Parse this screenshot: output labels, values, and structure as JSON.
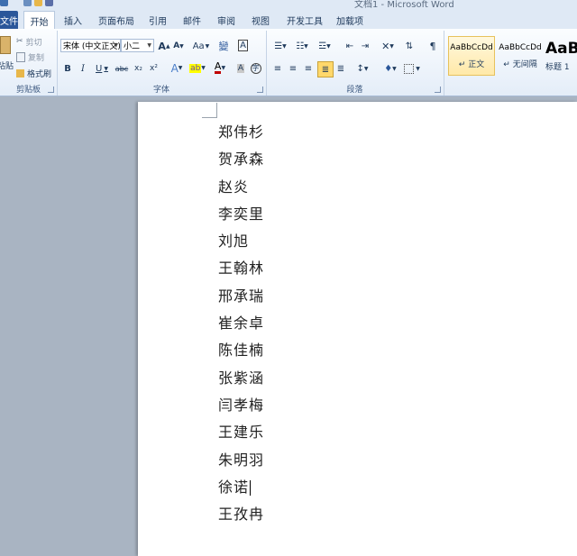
{
  "window": {
    "title": "文档1 - Microsoft Word"
  },
  "tabs": [
    "文件",
    "开始",
    "插入",
    "页面布局",
    "引用",
    "邮件",
    "审阅",
    "视图",
    "开发工具",
    "加载项"
  ],
  "active_tab": "开始",
  "clipboard": {
    "paste": "粘贴",
    "cut": "剪切",
    "copy": "复制",
    "format_painter": "格式刷",
    "label": "剪贴板"
  },
  "font": {
    "name": "宋体 (中文正文)",
    "size": "小二",
    "label": "字体",
    "bold": "B",
    "italic": "I",
    "underline": "U",
    "strike": "abc",
    "sub": "x₂",
    "sup": "x²",
    "grow": "A",
    "shrink": "A",
    "case": "Aa"
  },
  "paragraph": {
    "label": "段落"
  },
  "styles": [
    {
      "preview": "AaBbCcDd",
      "name": "正文",
      "selected": true
    },
    {
      "preview": "AaBbCcDd",
      "name": "无间隔",
      "selected": false
    },
    {
      "preview": "AaB",
      "name": "标题 1",
      "selected": false
    }
  ],
  "document": {
    "lines": [
      "郑伟杉",
      "贺承森",
      "赵炎",
      "李奕里",
      "刘旭",
      "王翰林",
      "邢承瑞",
      "崔余卓",
      "陈佳楠",
      "张紫涵",
      "闫孝梅",
      "王建乐",
      "朱明羽",
      "徐诺",
      "王孜冉"
    ],
    "cursor_line": 13
  },
  "colors": {
    "file_tab": "#2b579a",
    "ribbon_bg": "#e4edf8",
    "font_color": "#c00000",
    "highlight": "#ffff00",
    "selected_style": "#ffe9a8"
  }
}
